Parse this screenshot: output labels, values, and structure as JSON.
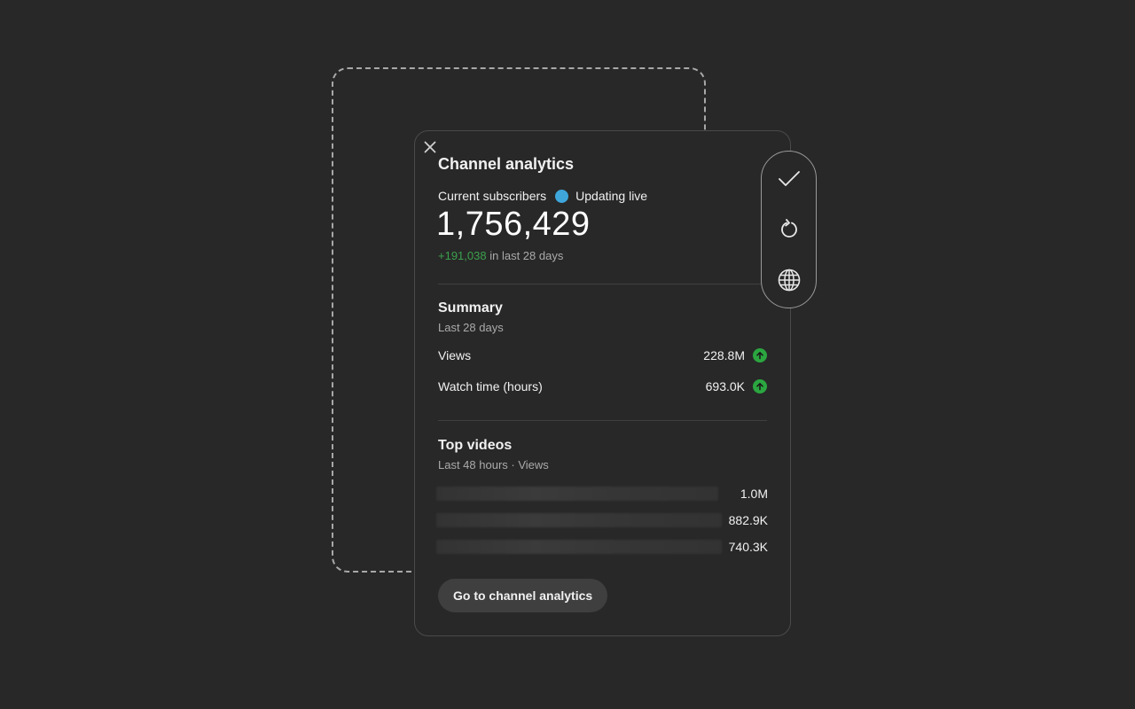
{
  "colors": {
    "background": "#282828",
    "live_dot": "#3ea6db",
    "positive": "#3ca04d",
    "up_badge": "#2ba640",
    "button_bg": "#3f3f3f"
  },
  "card": {
    "close_icon": "close-icon",
    "title": "Channel analytics",
    "subscribers_label": "Current subscribers",
    "live_label": "Updating live",
    "subscriber_count": "1,756,429",
    "delta_value": "+191,038",
    "delta_suffix": "in last 28 days"
  },
  "summary": {
    "title": "Summary",
    "period": "Last 28 days",
    "metrics": [
      {
        "label": "Views",
        "value": "228.8M",
        "trend_icon": "arrow-up-icon"
      },
      {
        "label": "Watch time (hours)",
        "value": "693.0K",
        "trend_icon": "arrow-up-icon"
      }
    ]
  },
  "top_videos": {
    "title": "Top videos",
    "period": "Last 48 hours · Views",
    "videos": [
      {
        "views": "1.0M"
      },
      {
        "views": "882.9K"
      },
      {
        "views": "740.3K"
      }
    ]
  },
  "cta": {
    "label": "Go to channel analytics"
  },
  "toolbar": {
    "icons": [
      "check-icon",
      "refresh-icon",
      "globe-icon"
    ]
  }
}
